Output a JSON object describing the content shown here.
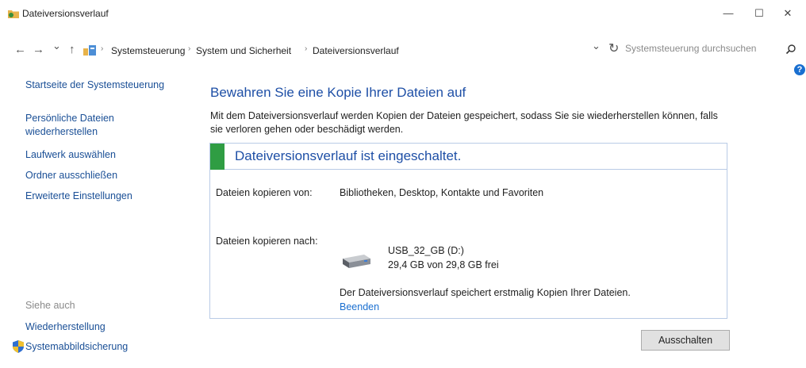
{
  "window": {
    "title": "Dateiversionsverlauf",
    "minimize_glyph": "—",
    "maximize_glyph": "☐",
    "close_glyph": "✕"
  },
  "nav": {
    "back_glyph": "←",
    "forward_glyph": "→",
    "recent_glyph": "⌄",
    "up_glyph": "↑",
    "breadcrumb": [
      "Systemsteuerung",
      "System und Sicherheit",
      "Dateiversionsverlauf"
    ],
    "sep_glyph": "›",
    "dropdown_glyph": "⌄",
    "refresh_glyph": "↻",
    "search_placeholder": "Systemsteuerung durchsuchen",
    "search_icon": "search-icon",
    "help_glyph": "?"
  },
  "sidebar": {
    "home": "Startseite der Systemsteuerung",
    "restore_line1": "Persönliche Dateien",
    "restore_line2": "wiederherstellen",
    "select_drive": "Laufwerk auswählen",
    "exclude_folders": "Ordner ausschließen",
    "advanced": "Erweiterte Einstellungen",
    "see_also": "Siehe auch",
    "recovery": "Wiederherstellung",
    "system_image": "Systemabbildsicherung"
  },
  "main": {
    "heading": "Bewahren Sie eine Kopie Ihrer Dateien auf",
    "description": "Mit dem Dateiversionsverlauf werden Kopien der Dateien gespeichert, sodass Sie sie wiederherstellen können, falls sie verloren gehen oder beschädigt werden.",
    "status": "Dateiversionsverlauf ist eingeschaltet.",
    "copy_from_label": "Dateien kopieren von:",
    "copy_from_value": "Bibliotheken, Desktop, Kontakte und Favoriten",
    "copy_to_label": "Dateien kopieren nach:",
    "drive_name": "USB_32_GB (D:)",
    "drive_free": "29,4 GB von 29,8 GB frei",
    "drive_icon": "usb-drive-icon",
    "info": "Der Dateiversionsverlauf speichert erstmalig Kopien Ihrer Dateien.",
    "stop_link": "Beenden",
    "turn_off_button": "Ausschalten"
  },
  "colors": {
    "link": "#1a4f96",
    "heading": "#1e4fa6",
    "status_green": "#2f9d43"
  }
}
